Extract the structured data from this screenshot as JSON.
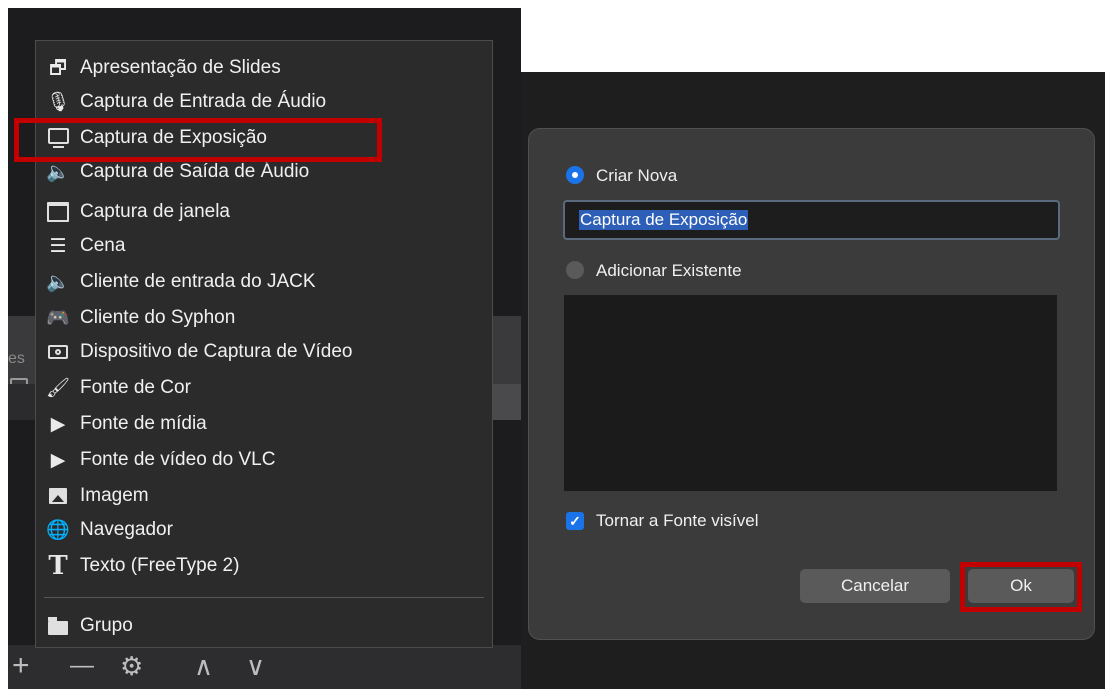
{
  "menu": {
    "items": [
      {
        "label": "Apresentação de Slides",
        "icon": "slideshow-icon"
      },
      {
        "label": "Captura de Entrada de Áudio",
        "icon": "microphone-icon"
      },
      {
        "label": "Captura de Exposição",
        "icon": "monitor-icon"
      },
      {
        "label": "Captura de Saída de Áudio",
        "icon": "speaker-icon"
      },
      {
        "label": "Captura de janela",
        "icon": "window-icon"
      },
      {
        "label": "Cena",
        "icon": "list-icon"
      },
      {
        "label": "Cliente de entrada do JACK",
        "icon": "speaker-icon"
      },
      {
        "label": "Cliente do Syphon",
        "icon": "gamepad-icon"
      },
      {
        "label": "Dispositivo de Captura de Vídeo",
        "icon": "camera-icon"
      },
      {
        "label": "Fonte de Cor",
        "icon": "brush-icon"
      },
      {
        "label": "Fonte de mídia",
        "icon": "play-icon"
      },
      {
        "label": "Fonte de vídeo do VLC",
        "icon": "play-icon"
      },
      {
        "label": "Imagem",
        "icon": "image-icon"
      },
      {
        "label": "Navegador",
        "icon": "globe-icon"
      },
      {
        "label": "Texto (FreeType 2)",
        "icon": "text-icon"
      },
      {
        "label": "Grupo",
        "icon": "folder-icon"
      }
    ]
  },
  "background_panel": {
    "partial_label": "es"
  },
  "bottom_toolbar": {
    "add": "+",
    "remove": "—",
    "settings": "⚙",
    "up": "∧",
    "down": "∨"
  },
  "dialog": {
    "create_new_label": "Criar Nova",
    "name_value": "Captura de Exposição",
    "add_existing_label": "Adicionar Existente",
    "make_visible_label": "Tornar a Fonte visível",
    "cancel_label": "Cancelar",
    "ok_label": "Ok"
  },
  "colors": {
    "highlight": "#c20000",
    "accent": "#1a73e8"
  }
}
